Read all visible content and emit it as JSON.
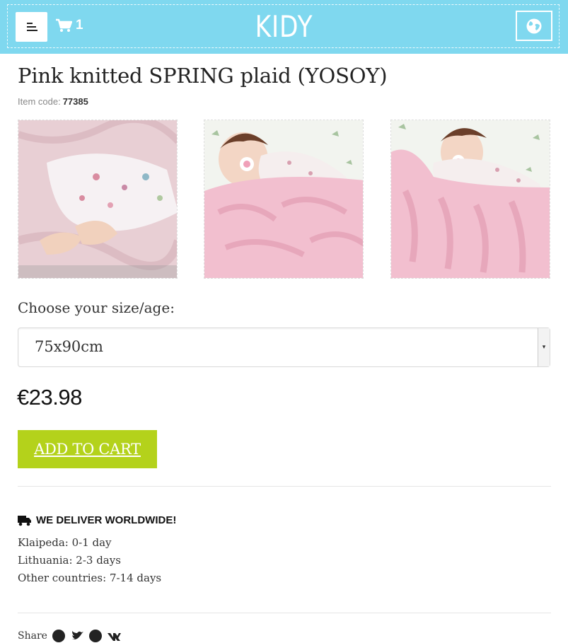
{
  "header": {
    "logo": "KIDY",
    "cart_count": "1",
    "colors": {
      "header_bg": "#7fd8ef",
      "accent": "#b4d21b"
    },
    "icons": {
      "menu": "menu-icon",
      "cart": "cart-icon",
      "language": "globe-icon"
    }
  },
  "product": {
    "title": "Pink knitted SPRING plaid (YOSOY)",
    "item_code_label": "Item code:",
    "item_code": "77385",
    "size_label": "Choose your size/age:",
    "size_selected": "75x90cm",
    "price": "€23.98",
    "add_to_cart": "ADD TO CART"
  },
  "delivery": {
    "heading": "WE DELIVER WORLDWIDE!",
    "lines": [
      "Klaipeda: 0-1 day",
      "Lithuania: 2-3 days",
      "Other countries: 7-14 days"
    ]
  },
  "share": {
    "label": "Share"
  }
}
